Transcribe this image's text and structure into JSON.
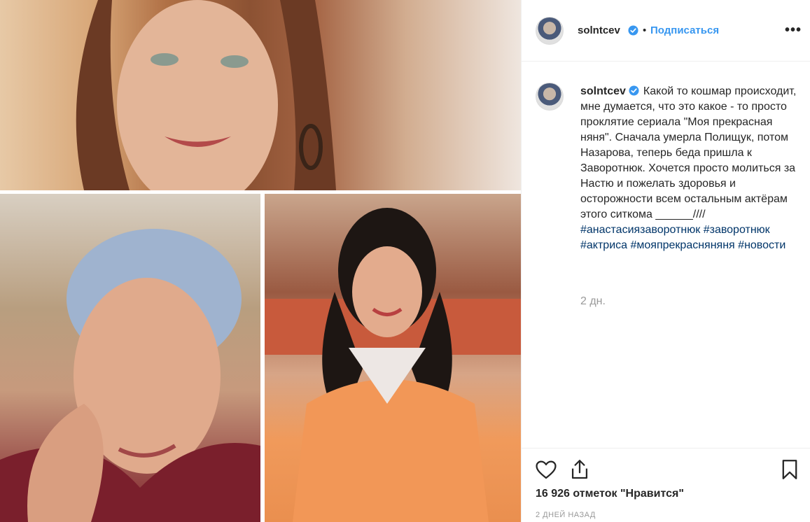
{
  "post": {
    "username": "solntcev",
    "dot": "•",
    "follow_label": "Подписаться",
    "more_label": "•••",
    "caption_text": "Какой то кошмар происходит, мне думается, что это какое - то просто проклятие сериала \"Моя прекрасная няня\". Сначала умерла Полищук, потом Назарова, теперь беда пришла к Заворотнюк. Хочется просто молиться за Настю и пожелать здоровья и осторожности всем остальным актёрам этого ситкома ______////",
    "hashtags": [
      "#анастасиязаворотнюк",
      "#заворотнюк",
      "#актриса",
      "#мояпрекрасняняня",
      "#новости"
    ],
    "age": "2 дн.",
    "likes": "16 926 отметок \"Нравится\"",
    "timestamp": "2 ДНЕЙ НАЗАД"
  },
  "icons": {
    "verified": "verified-badge-icon",
    "like": "heart-icon",
    "share": "share-icon",
    "save": "bookmark-icon"
  },
  "colors": {
    "link": "#3897f0",
    "hashtag": "#003569",
    "muted": "#999999",
    "text": "#262626"
  }
}
